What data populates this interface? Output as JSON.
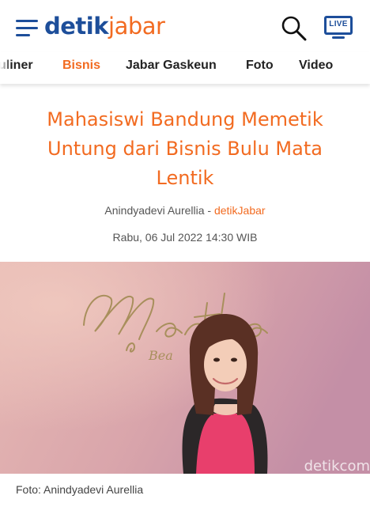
{
  "header": {
    "logo_main": "detik",
    "logo_sub": "jabar",
    "live_label": "LIVE",
    "icons": {
      "menu": "hamburger-menu-icon",
      "search": "search-icon",
      "live": "live-tv-icon"
    }
  },
  "nav": {
    "items": [
      {
        "label": "uliner",
        "active": false
      },
      {
        "label": "Bisnis",
        "active": true
      },
      {
        "label": "Jabar Gaskeun",
        "active": false
      },
      {
        "label": "Foto",
        "active": false
      },
      {
        "label": "Video",
        "active": false
      }
    ]
  },
  "article": {
    "title": "Mahasiswi Bandung Memetik Untung dari Bisnis Bulu Mata Lentik",
    "author": "Anindyadevi Aurellia",
    "separator": " - ",
    "source": "detikJabar",
    "date": "Rabu, 06 Jul 2022 14:30 WIB",
    "image": {
      "sign_text": "Martha",
      "sign_sub": "Bea",
      "watermark": "detikcom"
    },
    "caption": "Foto: Anindyadevi Aurellia"
  },
  "colors": {
    "brand_blue": "#1d4e9a",
    "accent_orange": "#f26b21",
    "photo_wall": "#dca9aa"
  }
}
